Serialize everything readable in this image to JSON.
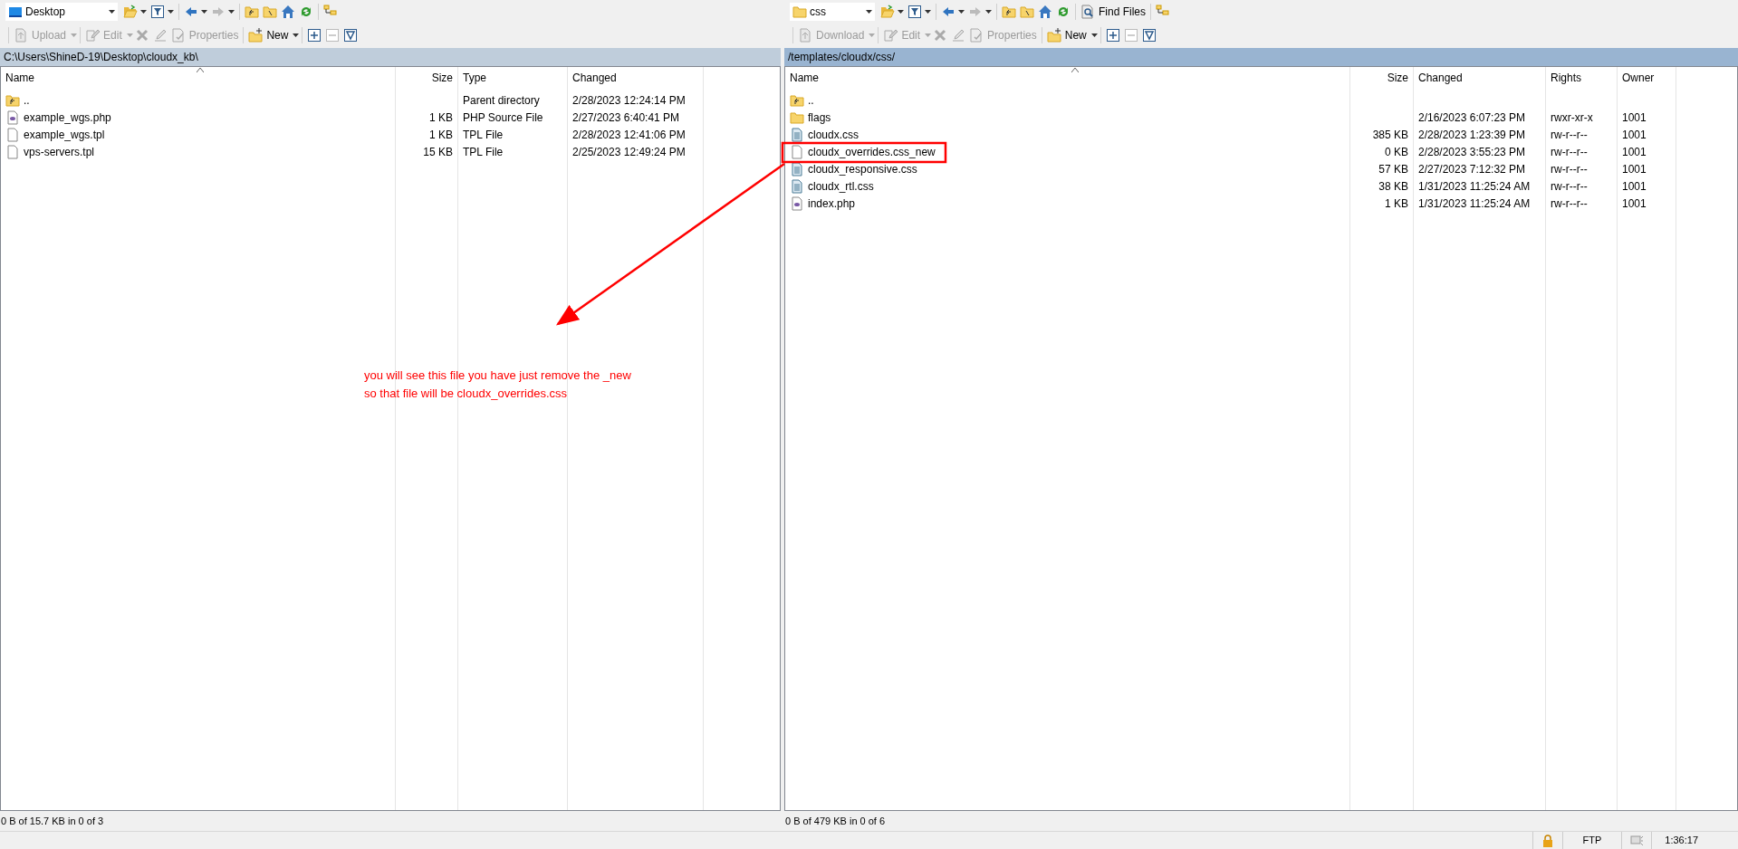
{
  "panels": [
    {
      "location": {
        "label": "Desktop",
        "kind": "desktop"
      },
      "transfer_button": {
        "label": "Upload",
        "disabled": true
      },
      "edit_button": {
        "label": "Edit",
        "disabled": true
      },
      "properties_button": {
        "label": "Properties",
        "disabled": true
      },
      "new_button": {
        "label": "New",
        "disabled": false
      },
      "path": "C:\\Users\\ShineD-19\\Desktop\\cloudx_kb\\",
      "active": false,
      "columns": [
        "Name",
        "Size",
        "Type",
        "Changed"
      ],
      "rows": [
        {
          "kind": "parent",
          "name": "..",
          "type": "Parent directory",
          "changed": "2/28/2023 12:24:14 PM"
        },
        {
          "kind": "php",
          "name": "example_wgs.php",
          "size": "1 KB",
          "type": "PHP Source File",
          "changed": "2/27/2023 6:40:41 PM"
        },
        {
          "kind": "file",
          "name": "example_wgs.tpl",
          "size": "1 KB",
          "type": "TPL File",
          "changed": "2/28/2023 12:41:06 PM"
        },
        {
          "kind": "file",
          "name": "vps-servers.tpl",
          "size": "15 KB",
          "type": "TPL File",
          "changed": "2/25/2023 12:49:24 PM"
        }
      ],
      "status": "0 B of 15.7 KB in 0 of 3"
    },
    {
      "location": {
        "label": "css",
        "kind": "folder"
      },
      "find_button": {
        "label": "Find Files"
      },
      "transfer_button": {
        "label": "Download",
        "disabled": true
      },
      "edit_button": {
        "label": "Edit",
        "disabled": true
      },
      "properties_button": {
        "label": "Properties",
        "disabled": true
      },
      "new_button": {
        "label": "New",
        "disabled": false
      },
      "path": "/templates/cloudx/css/",
      "active": true,
      "columns": [
        "Name",
        "Size",
        "Changed",
        "Rights",
        "Owner"
      ],
      "rows": [
        {
          "kind": "parent",
          "name": ".."
        },
        {
          "kind": "folder",
          "name": "flags",
          "changed": "2/16/2023 6:07:23 PM",
          "rights": "rwxr-xr-x",
          "owner": "1001"
        },
        {
          "kind": "css",
          "name": "cloudx.css",
          "size": "385 KB",
          "changed": "2/28/2023 1:23:39 PM",
          "rights": "rw-r--r--",
          "owner": "1001"
        },
        {
          "kind": "file",
          "name": "cloudx_overrides.css_new",
          "size": "0 KB",
          "changed": "2/28/2023 3:55:23 PM",
          "rights": "rw-r--r--",
          "owner": "1001"
        },
        {
          "kind": "css",
          "name": "cloudx_responsive.css",
          "size": "57 KB",
          "changed": "2/27/2023 7:12:32 PM",
          "rights": "rw-r--r--",
          "owner": "1001"
        },
        {
          "kind": "css",
          "name": "cloudx_rtl.css",
          "size": "38 KB",
          "changed": "1/31/2023 11:25:24 AM",
          "rights": "rw-r--r--",
          "owner": "1001"
        },
        {
          "kind": "php",
          "name": "index.php",
          "size": "1 KB",
          "changed": "1/31/2023 11:25:24 AM",
          "rights": "rw-r--r--",
          "owner": "1001"
        }
      ],
      "status": "0 B of 479 KB in 0 of 6"
    }
  ],
  "annotation": {
    "lines": [
      "you will see this file you have just remove the _new",
      "so that file will be cloudx_overrides.css"
    ]
  },
  "status_bar": {
    "protocol": "FTP",
    "time": "1:36:17"
  }
}
